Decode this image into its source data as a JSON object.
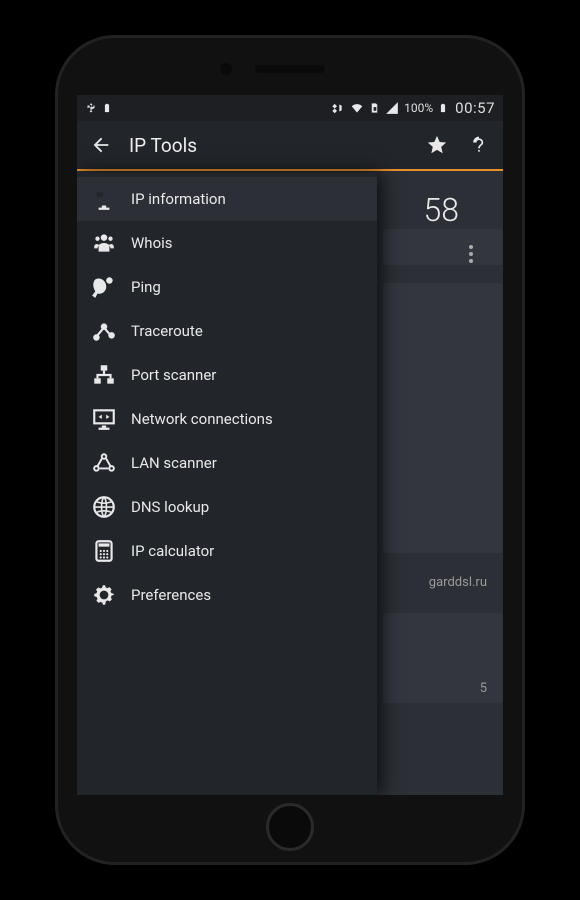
{
  "statusbar": {
    "battery_pct": "100%",
    "time": "00:57"
  },
  "appbar": {
    "title": "IP Tools"
  },
  "drawer": {
    "items": [
      {
        "label": "IP information",
        "icon": "monitor-icon",
        "selected": true
      },
      {
        "label": "Whois",
        "icon": "people-icon"
      },
      {
        "label": "Ping",
        "icon": "pingpong-icon"
      },
      {
        "label": "Traceroute",
        "icon": "route-icon"
      },
      {
        "label": "Port scanner",
        "icon": "network-icon"
      },
      {
        "label": "Network connections",
        "icon": "arrows-monitor-icon"
      },
      {
        "label": "LAN scanner",
        "icon": "lan-nodes-icon"
      },
      {
        "label": "DNS lookup",
        "icon": "globe-icon"
      },
      {
        "label": "IP calculator",
        "icon": "calculator-icon"
      },
      {
        "label": "Preferences",
        "icon": "gear-icon"
      }
    ]
  },
  "content": {
    "ip_fragment": "58",
    "host_fragment": "garddsl.ru",
    "id_fragment": "5"
  }
}
